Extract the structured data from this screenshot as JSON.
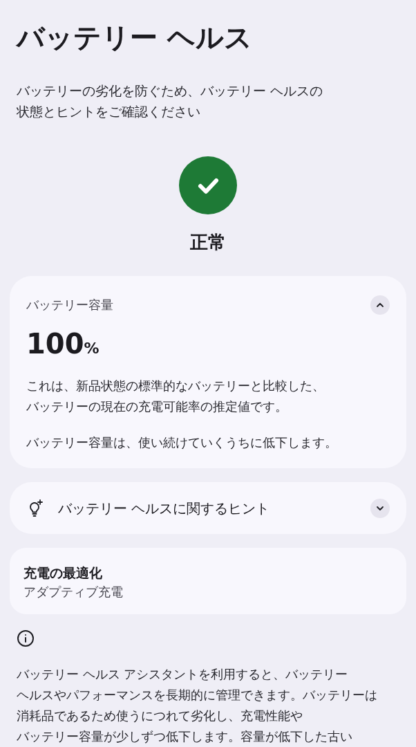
{
  "title": "バッテリー ヘルス",
  "intro_lines": [
    "バッテリーの劣化を防ぐため、バッテリー ヘルスの",
    "状態とヒントをご確認ください"
  ],
  "status": {
    "label": "正常",
    "kind": "ok"
  },
  "capacity_card": {
    "label": "バッテリー容量",
    "expanded": true,
    "value": "100",
    "unit": "%",
    "description_lines": [
      "これは、新品状態の標準的なバッテリーと比較した、",
      "バッテリーの現在の充電可能率の推定値です。"
    ],
    "note": "バッテリー容量は、使い続けていくうちに低下します。"
  },
  "tips_card": {
    "label": "バッテリー ヘルスに関するヒント",
    "expanded": false
  },
  "charging_card": {
    "title": "充電の最適化",
    "subtitle": "アダプティブ充電"
  },
  "footer_lines": [
    "バッテリー ヘルス アシスタントを利用すると、バッテリー",
    "ヘルスやパフォーマンスを長期的に管理できます。バッテリーは",
    "消耗品であるため使うにつれて劣化し、充電性能や",
    "バッテリー容量が少しずつ低下します。容量が低下した古い"
  ]
}
